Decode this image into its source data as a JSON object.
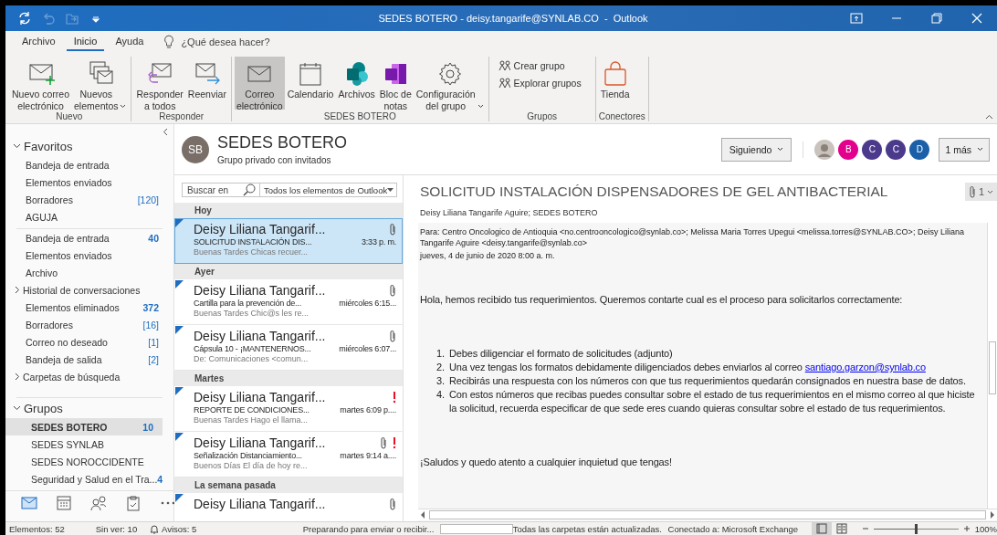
{
  "window": {
    "title": "SEDES BOTERO - deisy.tangarife@SYNLAB.CO  -  Outlook"
  },
  "quick_access": [
    {
      "disabled": false
    },
    {
      "disabled": true
    },
    {
      "disabled": true
    },
    {
      "disabled": false
    }
  ],
  "menu_tabs": [
    {
      "label": "Archivo",
      "selected": false
    },
    {
      "label": "Inicio",
      "selected": true
    },
    {
      "label": "Ayuda",
      "selected": false
    }
  ],
  "tell_me": {
    "placeholder": "¿Qué desea hacer?"
  },
  "ribbon_groups": [
    {
      "label": "Nuevo",
      "buttons": [
        {
          "kind": "large",
          "label": "Nuevo correo\nelectrónico",
          "dropdown": false,
          "selected": false
        },
        {
          "kind": "large",
          "label": "Nuevos\nelementos",
          "dropdown": true,
          "selected": false
        }
      ]
    },
    {
      "label": "Responder",
      "buttons": [
        {
          "kind": "large",
          "label": "Responder\na todos",
          "dropdown": false,
          "selected": false
        },
        {
          "kind": "large",
          "label": "Reenviar",
          "dropdown": false,
          "selected": false
        }
      ]
    },
    {
      "label": "SEDES BOTERO",
      "buttons": [
        {
          "kind": "large",
          "label": "Correo\nelectrónico",
          "dropdown": false,
          "selected": true
        },
        {
          "kind": "large",
          "label": "Calendario",
          "dropdown": false,
          "selected": false
        },
        {
          "kind": "large",
          "label": "Archivos",
          "dropdown": false,
          "selected": false
        },
        {
          "kind": "large",
          "label": "Bloc de\nnotas",
          "dropdown": false,
          "selected": false
        },
        {
          "kind": "large",
          "label": "Configuración\ndel grupo",
          "dropdown": true,
          "selected": false
        }
      ]
    },
    {
      "label": "Grupos",
      "buttons": [
        {
          "kind": "small",
          "label": "Crear grupo",
          "dropdown": false,
          "selected": false
        },
        {
          "kind": "small",
          "label": "Explorar grupos",
          "dropdown": false,
          "selected": false
        }
      ]
    },
    {
      "label": "Conectores",
      "buttons": [
        {
          "kind": "large",
          "label": "Tienda",
          "dropdown": false,
          "selected": false
        }
      ]
    }
  ],
  "sidebar": {
    "sections": [
      {
        "label": "Favoritos",
        "expanded": true,
        "items": [
          {
            "kind": "folder",
            "label": "Bandeja de entrada",
            "selected": false
          },
          {
            "kind": "folder",
            "label": "Elementos enviados",
            "selected": false
          },
          {
            "kind": "folder",
            "label": "Borradores",
            "count": "[120]",
            "unread": false,
            "selected": false
          },
          {
            "kind": "folder",
            "label": "AGUJA",
            "selected": false
          }
        ]
      },
      {
        "items": [
          {
            "kind": "folder",
            "label": "Bandeja de entrada",
            "count": "40",
            "unread": true,
            "selected": false
          },
          {
            "kind": "folder",
            "label": "Elementos enviados",
            "selected": false
          },
          {
            "kind": "folder",
            "label": "Archivo",
            "selected": false
          },
          {
            "kind": "branch",
            "label": "Historial de conversaciones",
            "selected": false
          },
          {
            "kind": "folder",
            "label": "Elementos eliminados",
            "count": "372",
            "unread": true,
            "selected": false
          },
          {
            "kind": "folder",
            "label": "Borradores",
            "count": "[16]",
            "unread": false,
            "selected": false
          },
          {
            "kind": "folder",
            "label": "Correo no deseado",
            "count": "[1]",
            "unread": false,
            "selected": false
          },
          {
            "kind": "folder",
            "label": "Bandeja de salida",
            "count": "[2]",
            "unread": false,
            "selected": false
          },
          {
            "kind": "branch",
            "label": "Carpetas de búsqueda",
            "selected": false
          }
        ]
      },
      {
        "label": "Grupos",
        "expanded": true,
        "items": [
          {
            "kind": "group",
            "label": "SEDES BOTERO",
            "count": "10",
            "unread": true,
            "selected": true
          },
          {
            "kind": "group",
            "label": "SEDES SYNLAB",
            "selected": false
          },
          {
            "kind": "group",
            "label": "SEDES NOROCCIDENTE",
            "selected": false
          },
          {
            "kind": "group",
            "label": "Seguridad y Salud en el Tra...",
            "count": "4",
            "unread": true,
            "selected": false
          }
        ]
      }
    ],
    "nav": [
      {
        "selected": true
      },
      {
        "selected": false
      },
      {
        "selected": false
      },
      {
        "selected": false
      },
      {
        "selected": false
      }
    ]
  },
  "group_header": {
    "initials": "SB",
    "name": "SEDES BOTERO",
    "subtitle": "Grupo privado con invitados",
    "follow_button": "Siguiendo",
    "members": [
      {
        "kind": "photo"
      },
      {
        "kind": "initial",
        "initial": "B",
        "color": "#e3008c"
      },
      {
        "kind": "initial",
        "initial": "C",
        "color": "#4b3a8c"
      },
      {
        "kind": "initial",
        "initial": "C",
        "color": "#4b3a8c"
      },
      {
        "kind": "initial",
        "initial": "D",
        "color": "#1a5fa8"
      }
    ],
    "more_button": "1 más"
  },
  "search": {
    "placeholder": "Buscar en",
    "scope": "Todos los elementos de Outlook"
  },
  "mail_groups": [
    {
      "label": "Hoy",
      "messages": [
        {
          "sender": "Deisy Liliana Tangarif...",
          "subject": "SOLICITUD INSTALACIÓN DIS...",
          "time": "3:33 p. m.",
          "preview": "Buenas Tardes  Chicas recuer...",
          "attachment": true,
          "important": false,
          "unread": true,
          "selected": true
        }
      ]
    },
    {
      "label": "Ayer",
      "messages": [
        {
          "sender": "Deisy Liliana Tangarif...",
          "subject": "Cartilla para la prevención de...",
          "time": "miércoles 6:15...",
          "preview": "Buenas Tardes  Chic@s les re...",
          "attachment": true,
          "important": false,
          "unread": true,
          "selected": false
        },
        {
          "sender": "Deisy Liliana Tangarif...",
          "subject": "Cápsula 10 - ¡MANTENERNOS...",
          "time": "miércoles 6:07...",
          "preview": "De: Comunicaciones <comun...",
          "attachment": true,
          "important": false,
          "unread": true,
          "selected": false
        }
      ]
    },
    {
      "label": "Martes",
      "messages": [
        {
          "sender": "Deisy Liliana Tangarif...",
          "subject": "REPORTE DE CONDICIONES...",
          "time": "martes 6:09 p....",
          "preview": "Buenas Tardes  Hago el llama...",
          "attachment": false,
          "important": true,
          "unread": true,
          "selected": false
        },
        {
          "sender": "Deisy Liliana Tangarif...",
          "subject": "Señalización Distanciamiento...",
          "time": "martes 9:14 a....",
          "preview": "Buenos Días  El día de hoy re...",
          "attachment": true,
          "important": true,
          "unread": true,
          "selected": false
        }
      ]
    },
    {
      "label": "La semana pasada",
      "messages": [
        {
          "sender": "Deisy Liliana Tangarif...",
          "attachment": true,
          "important": false,
          "unread": true,
          "selected": false
        }
      ]
    }
  ],
  "reading_pane": {
    "subject": "SOLICITUD INSTALACIÓN DISPENSADORES DE GEL ANTIBACTERIAL",
    "attachment_count": "1",
    "from": "Deisy Liliana Tangarife Aguire; SEDES BOTERO",
    "to": "Para: Centro Oncologico de Antioquia <no.centrooncologico@synlab.co>; Melissa Maria Torres Upegui <melissa.torres@SYNLAB.CO>; Deisy Liliana Tangarife Aguire <deisy.tangarife@synlab.co>",
    "date": "jueves, 4 de junio de 2020 8:00 a. m.",
    "greeting": "Hola, hemos recibido tus requerimientos. Queremos contarte cual es el proceso para solicitarlos correctamente:",
    "steps": [
      {
        "number": "1.",
        "text": "Debes diligenciar el formato de solicitudes (adjunto)"
      },
      {
        "number": "2.",
        "text": "Una vez tengas los formatos debidamente diligenciados debes enviarlos al correo ",
        "link": "santiago.garzon@synlab.co"
      },
      {
        "number": "3.",
        "text": "Recibirás una respuesta con los números con que tus requerimientos quedarán consignados en nuestra base de datos."
      },
      {
        "number": "4.",
        "text": "Con estos números que recibas puedes consultar sobre el estado de tus requerimientos en el mismo correo al que hiciste la solicitud, recuerda especificar de que sede eres cuando quieras consultar sobre el estado de tus requerimientos."
      }
    ],
    "closing": "¡Saludos y quedo atento a cualquier inquietud que tengas!"
  },
  "status_bar": {
    "items": "Elementos: 52",
    "unread": "Sin ver: 10",
    "reminders": "Avisos: 5",
    "sync": "Preparando para enviar o recibir...",
    "folders": "Todas las carpetas están actualizadas.",
    "connection": "Conectado a: Microsoft Exchange",
    "views": [
      {
        "selected": true
      },
      {
        "selected": false
      }
    ],
    "zoom": {
      "level": 0.5,
      "reading": "100%"
    }
  }
}
